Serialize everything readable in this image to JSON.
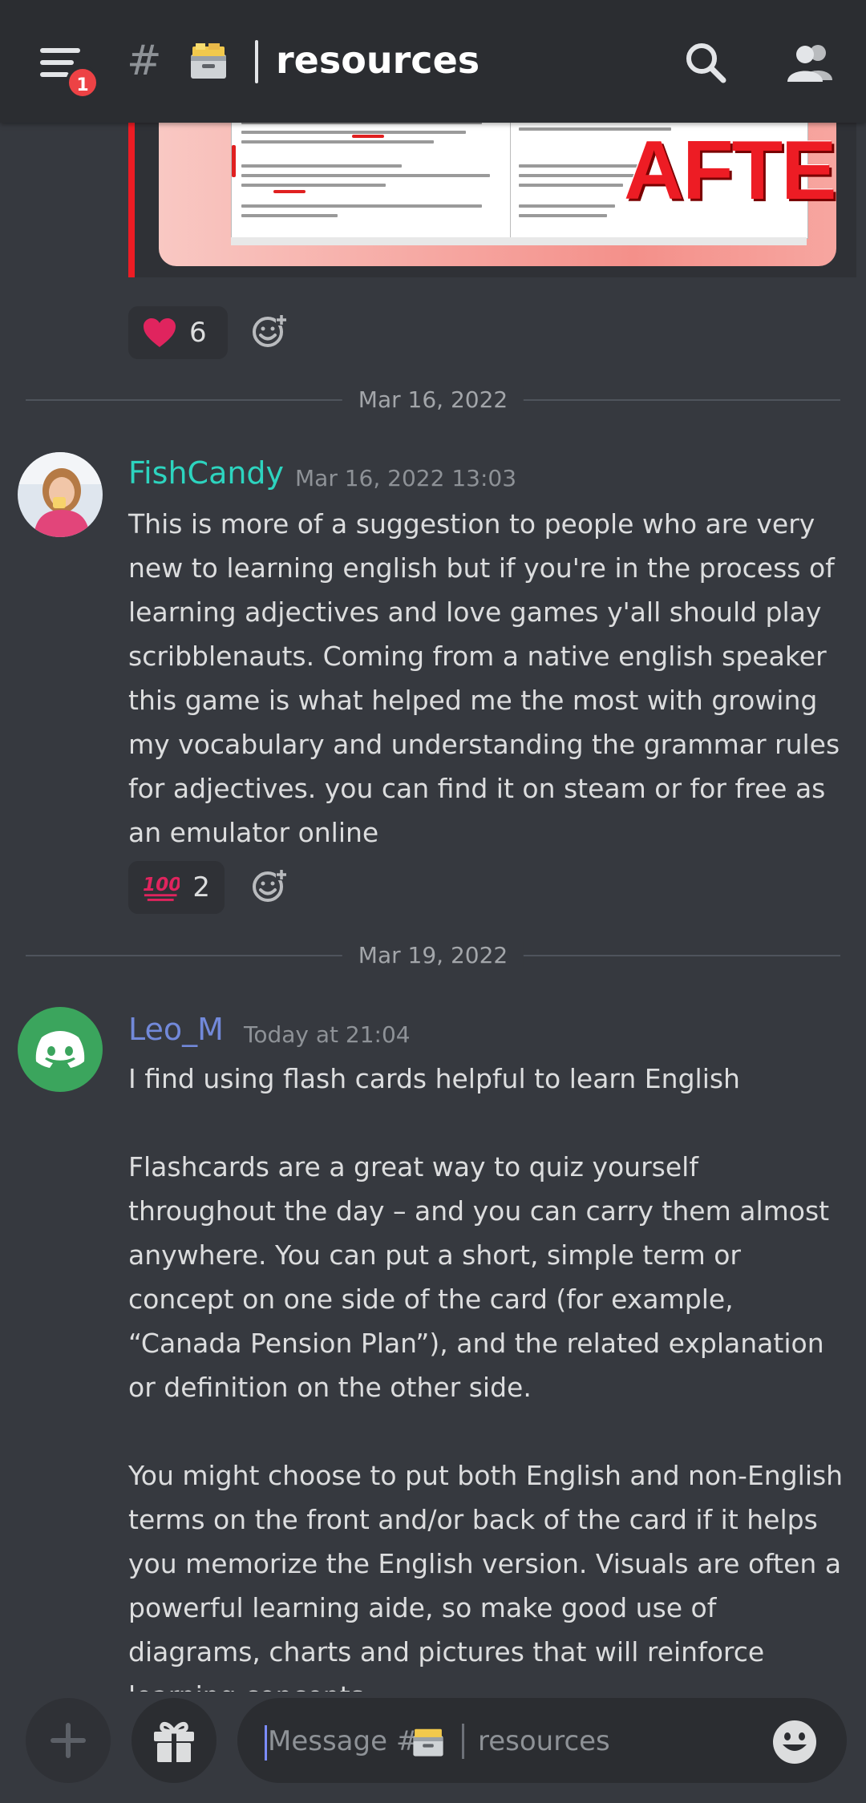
{
  "header": {
    "notification_count": "1",
    "hash": "#",
    "channel_name": "resources"
  },
  "embed": {
    "overlay_text": "AFTER",
    "reaction": {
      "emoji": "heart",
      "count": "6"
    }
  },
  "dividers": [
    "Mar 16, 2022",
    "Mar 19, 2022"
  ],
  "messages": [
    {
      "author": "FishCandy",
      "author_color": "#2dd4bf",
      "timestamp": "Mar 16, 2022 13:03",
      "text": "This is more of a suggestion to people who are very new to learning english but if you're in the process of learning adjectives and love games y'all should play scribblenauts. Coming from a native english speaker this game is what helped me the most with growing my vocabulary and understanding the grammar rules for adjectives. you can find it on steam or for free as an emulator online",
      "reaction": {
        "emoji": "100",
        "count": "2"
      }
    },
    {
      "author": "Leo_M",
      "author_color": "#5865f2",
      "timestamp": "Today at 21:04",
      "text": "I find using flash cards helpful to learn English\n\nFlashcards are a great way to quiz yourself throughout the day – and you can carry them almost anywhere. You can put a short, simple term or concept on one side of the card (for example, “Canada Pension Plan”), and the related explanation or definition on the other side.\n\nYou might choose to put both English and non-English terms on the front and/or back of the card if it helps you memorize the English version. Visuals are often a powerful learning aide, so make good use of diagrams, charts and pictures that will reinforce learning concepts."
    }
  ],
  "composer": {
    "placeholder_prefix": "Message #",
    "placeholder_channel": "resources"
  },
  "colors": {
    "background": "#36393f",
    "accent_red": "#ed4245",
    "discord_green": "#3ba55d"
  }
}
